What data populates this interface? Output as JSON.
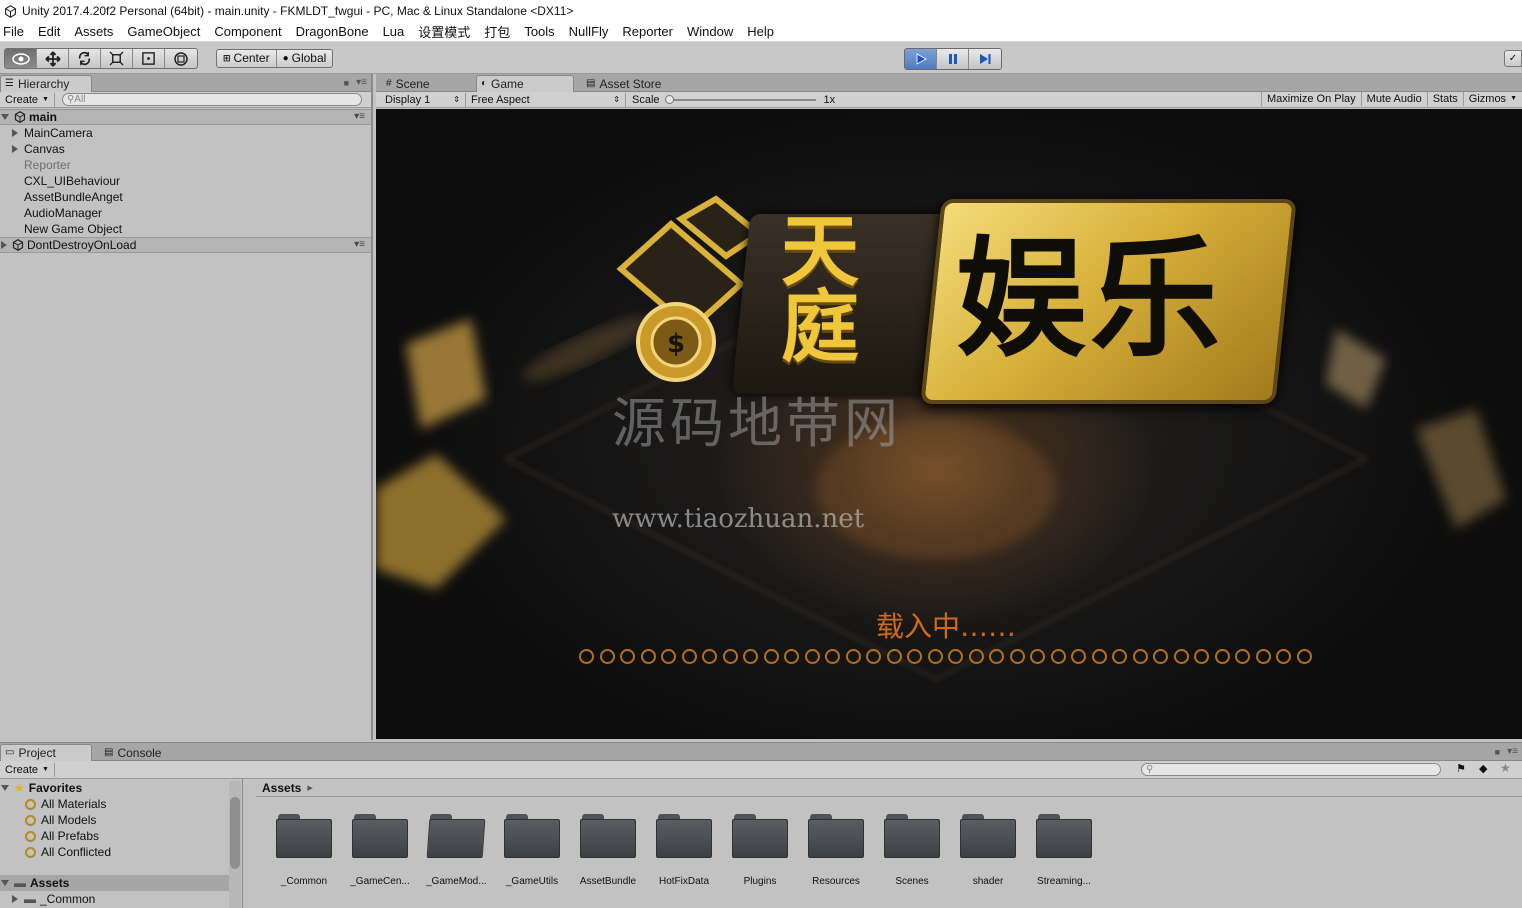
{
  "window": {
    "title": "Unity 2017.4.20f2 Personal (64bit) - main.unity - FKMLDT_fwgui - PC, Mac & Linux Standalone <DX11>"
  },
  "menu": [
    "File",
    "Edit",
    "Assets",
    "GameObject",
    "Component",
    "DragonBone",
    "Lua",
    "设置模式",
    "打包",
    "Tools",
    "NullFly",
    "Reporter",
    "Window",
    "Help"
  ],
  "toolbar": {
    "pivot": "Center",
    "space": "Global"
  },
  "hierarchy": {
    "tab": "Hierarchy",
    "create": "Create",
    "search_placeholder": "All",
    "scene": "main",
    "items": [
      "MainCamera",
      "Canvas",
      "Reporter",
      "CXL_UIBehaviour",
      "AssetBundleAnget",
      "AudioManager",
      "New Game Object"
    ],
    "dontdestroy": "DontDestroyOnLoad"
  },
  "gameview": {
    "tabs": [
      "Scene",
      "Game",
      "Asset Store"
    ],
    "display": "Display 1",
    "aspect": "Free Aspect",
    "scale_label": "Scale",
    "scale_value": "1x",
    "right_buttons": [
      "Maximize On Play",
      "Mute Audio",
      "Stats",
      "Gizmos"
    ],
    "logo_left": "天庭",
    "logo_right": "娱乐",
    "watermark_cn": "源码地带网",
    "watermark_url": "www.tiaozhuan.net",
    "loading_text": "载入中……",
    "loading_dots": 36
  },
  "project": {
    "tabs": [
      "Project",
      "Console"
    ],
    "create": "Create",
    "favorites_label": "Favorites",
    "favorites": [
      "All Materials",
      "All Models",
      "All Prefabs",
      "All Conflicted"
    ],
    "assets_root": "Assets",
    "tree_first": "_Common",
    "breadcrumb": "Assets",
    "folders": [
      "_Common",
      "_GameCen...",
      "_GameMod...",
      "_GameUtils",
      "AssetBundle",
      "HotFixData",
      "Plugins",
      "Resources",
      "Scenes",
      "shader",
      "Streaming..."
    ]
  },
  "colors": {
    "play_active": "#4f7cbf",
    "gold": "#d9b23a",
    "loading_orange": "#d06b1c"
  }
}
